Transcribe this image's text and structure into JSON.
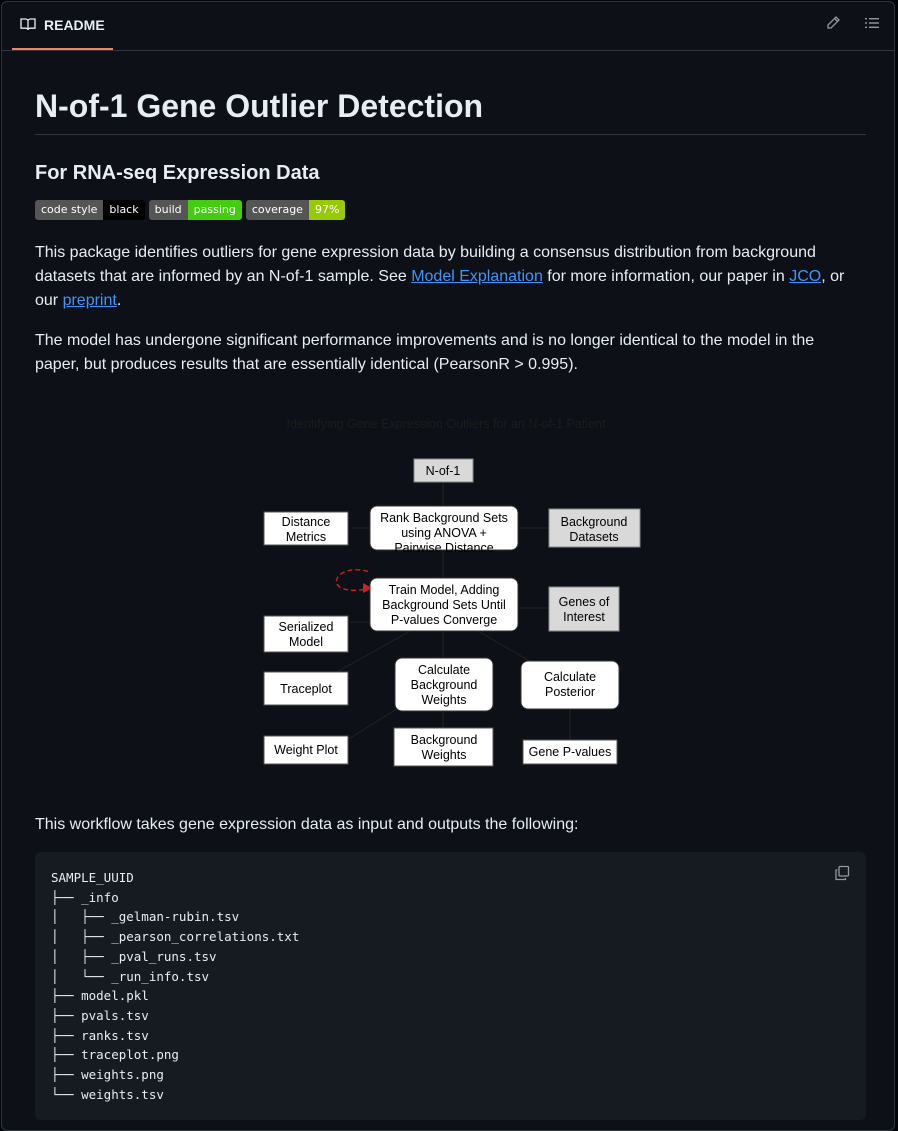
{
  "header": {
    "tab_label": "README"
  },
  "title": "N-of-1 Gene Outlier Detection",
  "subtitle": "For RNA-seq Expression Data",
  "badges": [
    {
      "left": "code style",
      "right": "black",
      "color": "#000000"
    },
    {
      "left": "build",
      "right": "passing",
      "color": "#4c1"
    },
    {
      "left": "coverage",
      "right": "97%",
      "color": "#97ca00"
    }
  ],
  "intro": {
    "text1": "This package identifies outliers for gene expression data by building a consensus distribution from background datasets that are informed by an N-of-1 sample. See ",
    "link_model": "Model Explanation",
    "text2": " for more information, our paper in ",
    "link_jco": "JCO",
    "text3": ", or our ",
    "link_preprint": "preprint",
    "text4": "."
  },
  "performance_note": "The model has undergone significant performance improvements and is no longer identical to the model in the paper, but produces results that are essentially identical (PearsonR > 0.995).",
  "diagram": {
    "title": "Identifying Gene Expression Outliers for an N-of-1 Patient",
    "nodes": {
      "nof1": "N-of-1",
      "rank_l1": "Rank Background Sets",
      "rank_l2": "using ANOVA +",
      "rank_l3": "Pairwise Distance",
      "distance_l1": "Distance",
      "distance_l2": "Metrics",
      "bgdata_l1": "Background",
      "bgdata_l2": "Datasets",
      "train_l1": "Train Model, Adding",
      "train_l2": "Background Sets Until",
      "train_l3": "P-values Converge",
      "genes_l1": "Genes of",
      "genes_l2": "Interest",
      "serial_l1": "Serialized",
      "serial_l2": "Model",
      "calcbg_l1": "Calculate",
      "calcbg_l2": "Background",
      "calcbg_l3": "Weights",
      "calcpost_l1": "Calculate",
      "calcpost_l2": "Posterior",
      "traceplot": "Traceplot",
      "weightplot": "Weight Plot",
      "bgweights_l1": "Background",
      "bgweights_l2": "Weights",
      "genepvals": "Gene P-values"
    }
  },
  "workflow_intro": "This workflow takes gene expression data as input and outputs the following:",
  "code_tree": "SAMPLE_UUID\n├── _info\n│   ├── _gelman-rubin.tsv\n│   ├── _pearson_correlations.txt\n│   ├── _pval_runs.tsv\n│   └── _run_info.tsv\n├── model.pkl\n├── pvals.tsv\n├── ranks.tsv\n├── traceplot.png\n├── weights.png\n└── weights.tsv"
}
